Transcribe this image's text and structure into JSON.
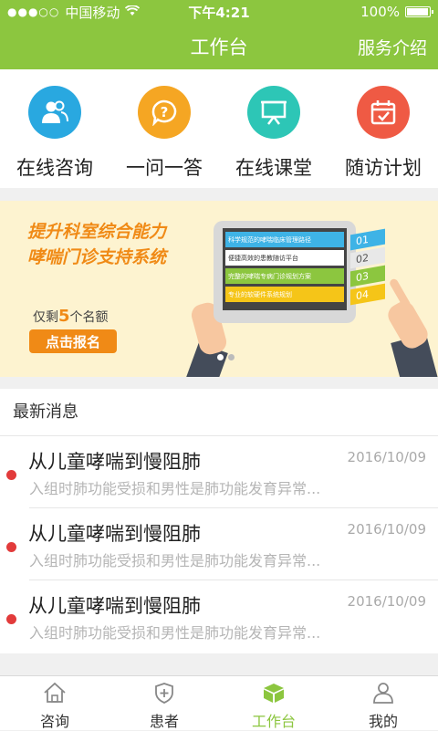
{
  "status": {
    "carrier": "中国移动",
    "time": "下午4:21",
    "battery": "100%"
  },
  "header": {
    "title": "工作台",
    "action": "服务介绍"
  },
  "quick_actions": [
    {
      "label": "在线咨询",
      "icon": "consultation-people-icon",
      "color": "#29a8e0"
    },
    {
      "label": "一问一答",
      "icon": "question-icon",
      "color": "#f5a623"
    },
    {
      "label": "在线课堂",
      "icon": "classroom-board-icon",
      "color": "#2dc6b6"
    },
    {
      "label": "随访计划",
      "icon": "calendar-icon",
      "color": "#ef5a44"
    }
  ],
  "banner": {
    "title_line1": "提升科室综合能力",
    "title_line2": "哮喘门诊支持系统",
    "remain_prefix": "仅剩",
    "remain_count": "5",
    "remain_suffix": "个名额",
    "cta": "点击报名",
    "tablet_rows": [
      "科学规范的哮喘临床管理路径",
      "便捷高效的患教随访平台",
      "完整的哮喘专病门诊规划方案",
      "专业的软硬件系统规划"
    ],
    "tags": [
      "01",
      "02",
      "03",
      "04"
    ]
  },
  "news": {
    "heading": "最新消息",
    "items": [
      {
        "title": "从儿童哮喘到慢阻肺",
        "date": "2016/10/09",
        "summary": "入组时肺功能受损和男性是肺功能发育异常..."
      },
      {
        "title": "从儿童哮喘到慢阻肺",
        "date": "2016/10/09",
        "summary": "入组时肺功能受损和男性是肺功能发育异常..."
      },
      {
        "title": "从儿童哮喘到慢阻肺",
        "date": "2016/10/09",
        "summary": "入组时肺功能受损和男性是肺功能发育异常..."
      }
    ]
  },
  "tabbar": [
    {
      "label": "咨询",
      "icon": "home-icon"
    },
    {
      "label": "患者",
      "icon": "shield-plus-icon"
    },
    {
      "label": "工作台",
      "icon": "box-icon",
      "active": true
    },
    {
      "label": "我的",
      "icon": "user-icon"
    }
  ],
  "colors": {
    "brand": "#8cc63f",
    "accent": "#f08a16",
    "unread": "#e23b3b"
  }
}
